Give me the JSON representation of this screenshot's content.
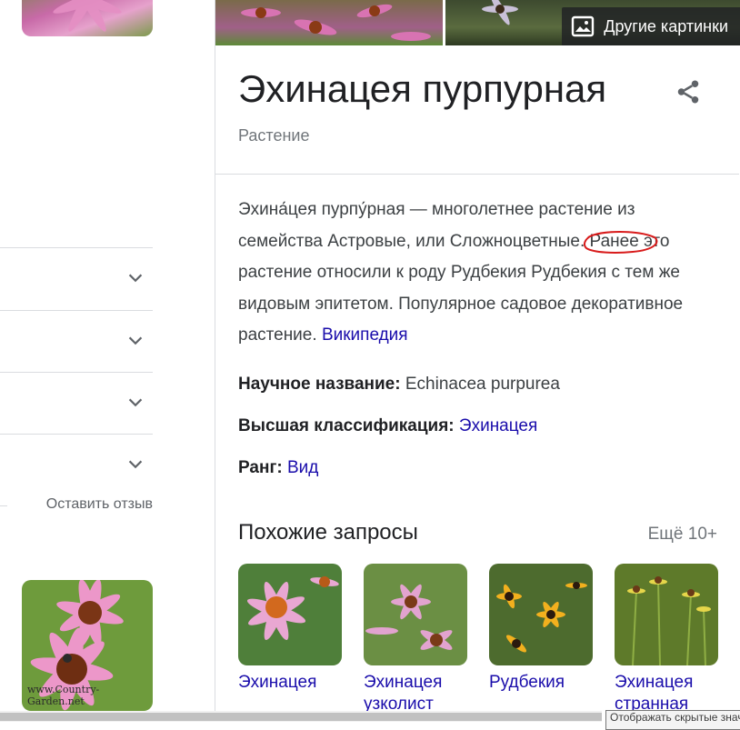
{
  "left": {
    "accordion_rows": 4,
    "feedback": "Оставить отзыв",
    "watermark": "www.Country-Garden.net"
  },
  "panel": {
    "more_images": "Другие картинки",
    "title": "Эхинацея пурпурная",
    "subtitle": "Растение",
    "description": {
      "part1": "Эхина́цея пурпу́рная — многолетнее растение из семейства Астровые, или Сложноцветные.",
      "highlight": "Ранее",
      "part2": "это растение относили к роду Рудбекия Рудбекия с тем же видовым эпитетом. Популярное садовое декоративное растение.",
      "source": "Википедия"
    },
    "facts": [
      {
        "label": "Научное название:",
        "value": "Echinacea purpurea",
        "is_link": false
      },
      {
        "label": "Высшая классификация:",
        "value": "Эхинацея",
        "is_link": true
      },
      {
        "label": "Ранг:",
        "value": "Вид",
        "is_link": true
      }
    ],
    "related": {
      "title": "Похожие запросы",
      "more": "Ещё 10+",
      "items": [
        {
          "label": "Эхинацея"
        },
        {
          "label": "Эхинацея узколист"
        },
        {
          "label": "Рудбекия"
        },
        {
          "label": "Эхинацея странная"
        }
      ]
    }
  },
  "tooltip": "Отображать скрытые значки",
  "colors": {
    "link": "#1a0dab",
    "annotation": "#d81b1b"
  }
}
